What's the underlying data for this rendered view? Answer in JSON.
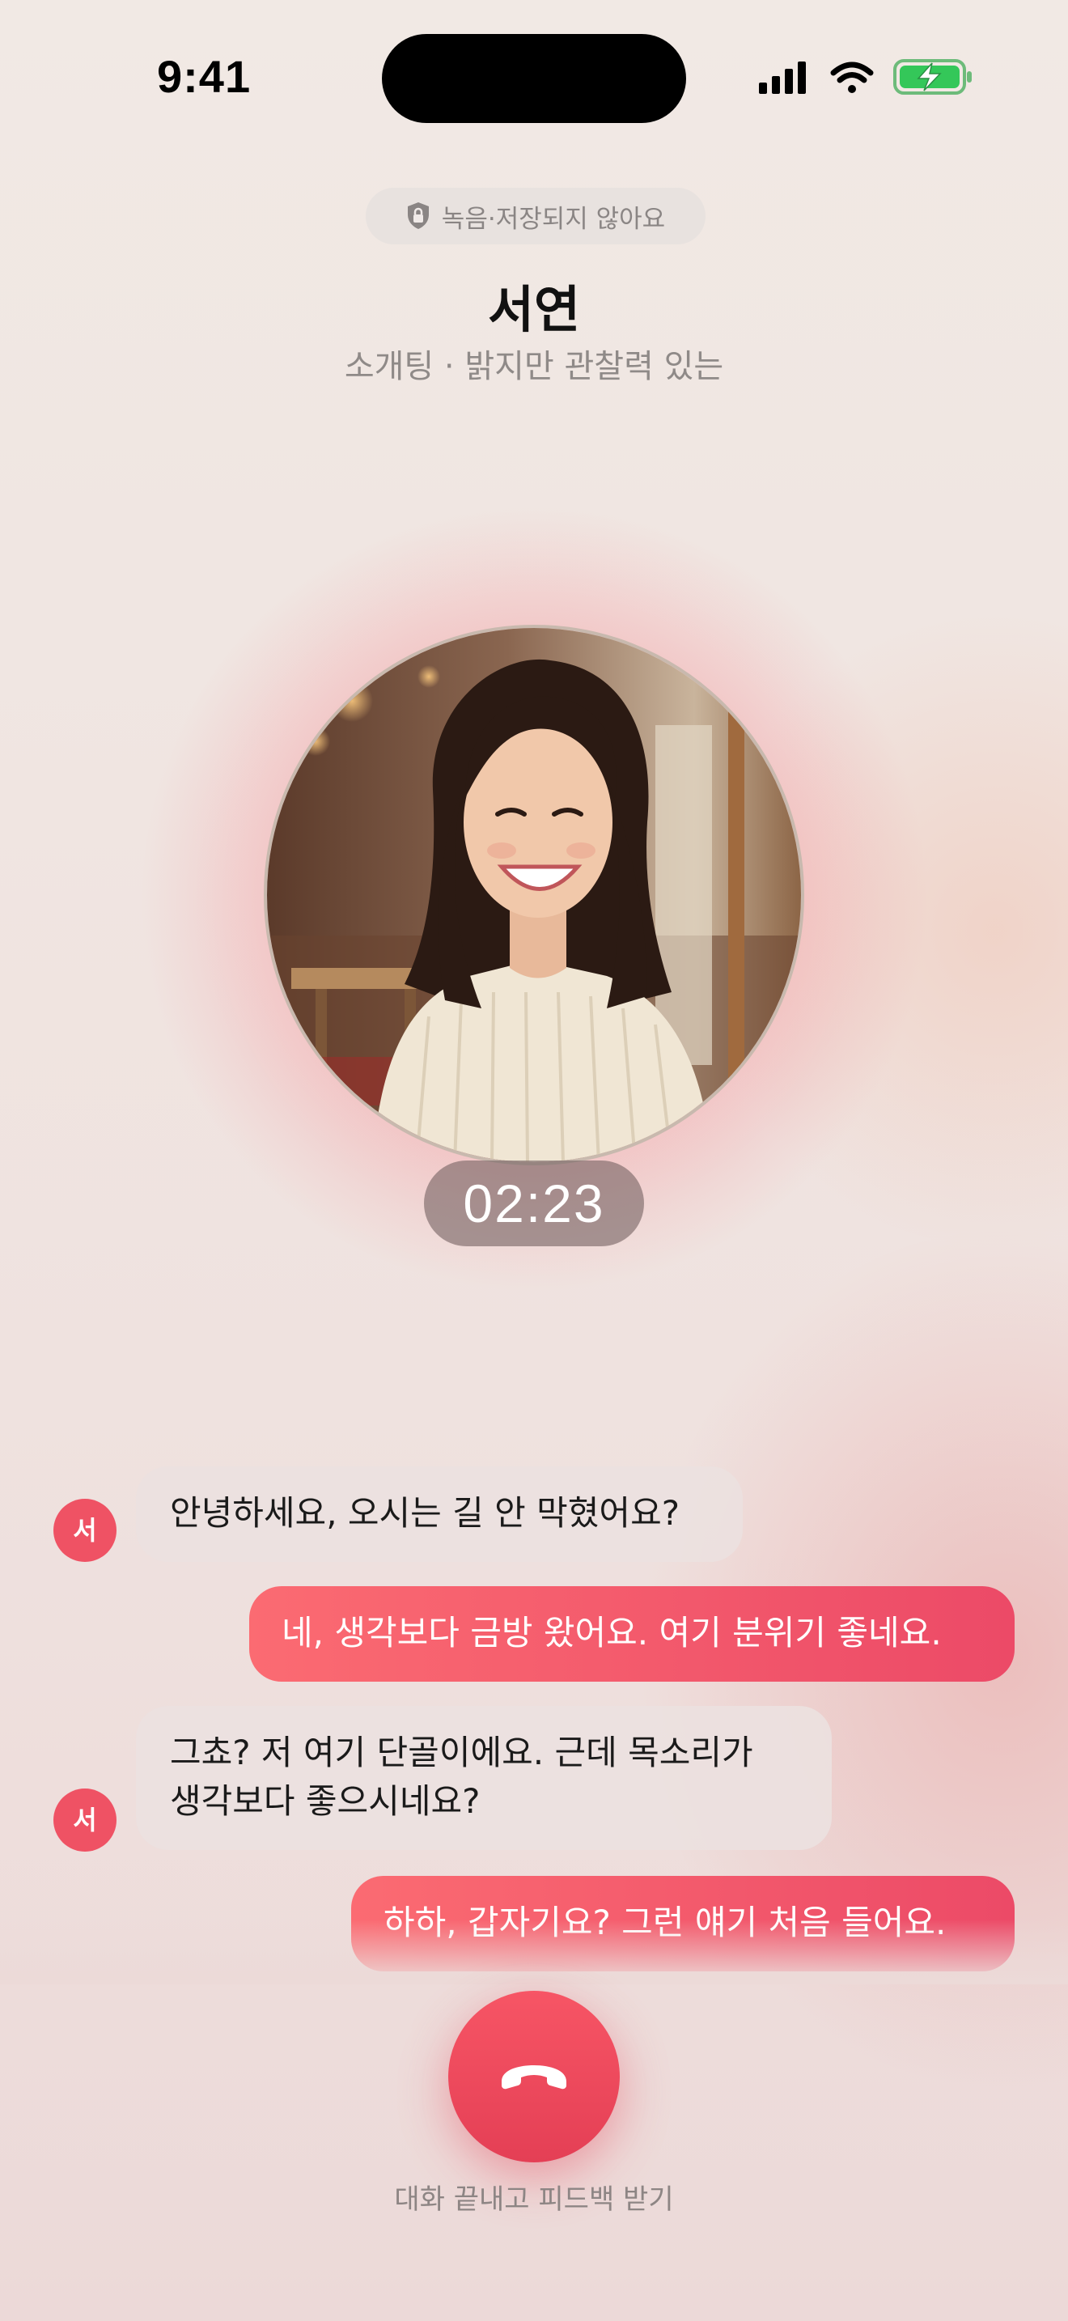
{
  "status_bar": {
    "time": "9:41",
    "icons": [
      "cellular-signal-icon",
      "wifi-icon",
      "battery-charging-icon"
    ]
  },
  "header": {
    "privacy_text": "녹음·저장되지 않아요",
    "privacy_icon": "shield-lock-icon",
    "name": "서연",
    "subtitle": "소개팅 · 밝지만 관찰력 있는"
  },
  "call": {
    "timer": "02:23"
  },
  "messages": [
    {
      "from": "them",
      "avatar_text": "서",
      "text": "안녕하세요, 오시는 길 안 막혔어요?"
    },
    {
      "from": "me",
      "text": "네, 생각보다 금방 왔어요. 여기 분위기 좋네요."
    },
    {
      "from": "them",
      "avatar_text": "서",
      "text_line1": "그쵸? 저 여기 단골이에요. 근데 목소리가",
      "text_line2": "생각보다 좋으시네요?"
    },
    {
      "from": "me",
      "text": "하하, 갑자기요? 그런 얘기 처음 들어요."
    }
  ],
  "end_call": {
    "icon": "phone-hangup-icon",
    "label": "대화 끝내고 피드백 받기"
  },
  "colors": {
    "accent": "#ef5264",
    "background": "#f1e9e4",
    "battery": "#34c759"
  }
}
